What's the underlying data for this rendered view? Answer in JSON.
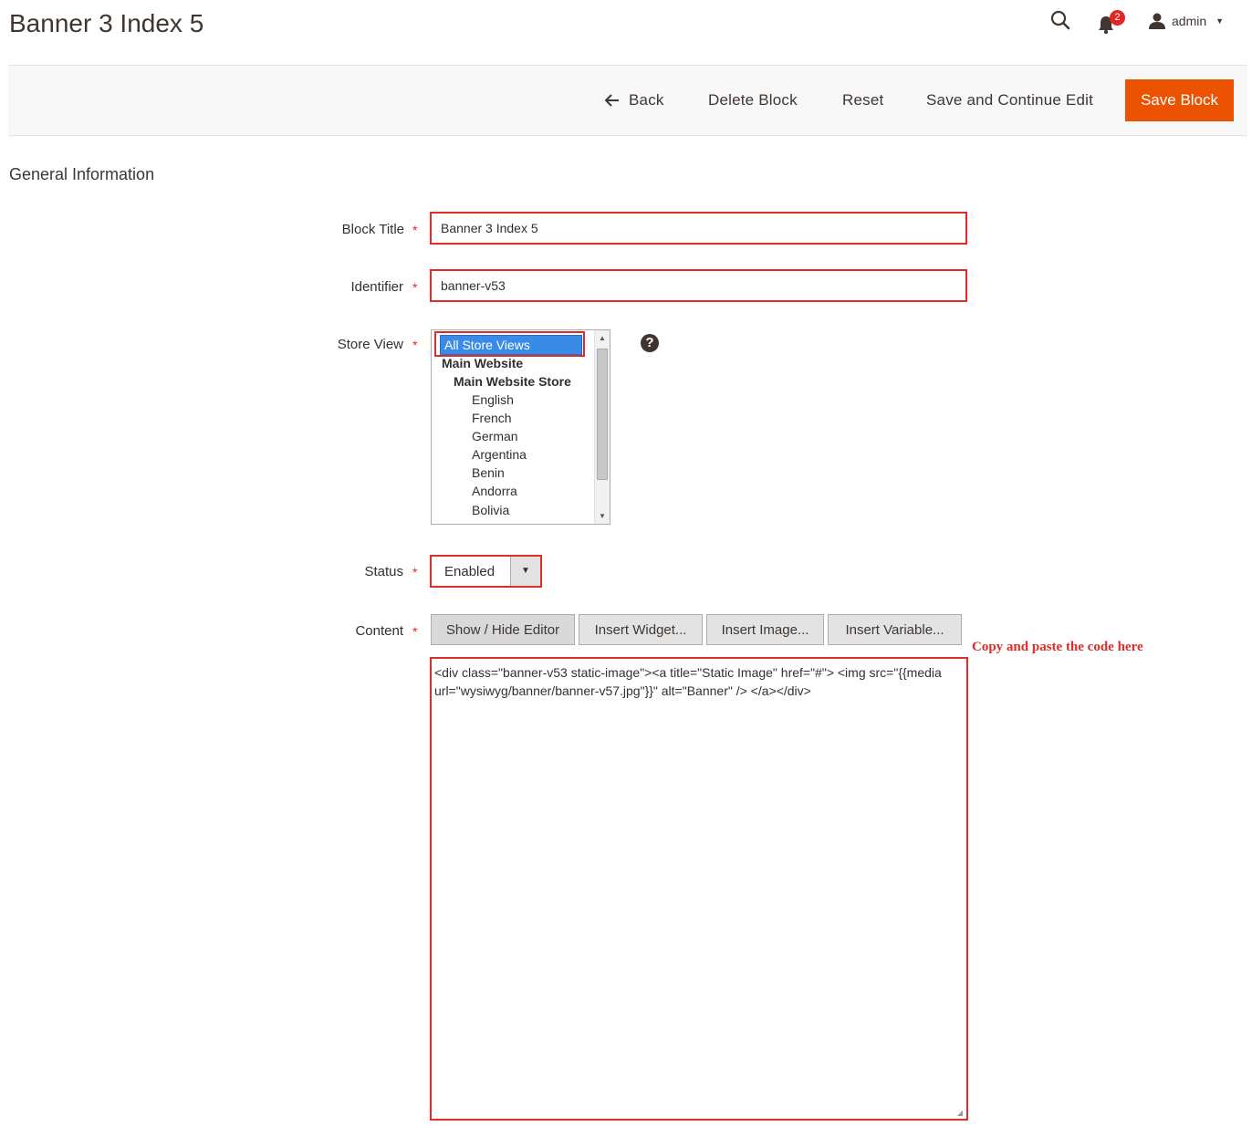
{
  "page": {
    "title": "Banner 3 Index 5"
  },
  "header": {
    "notifications_count": "2",
    "user_name": "admin"
  },
  "toolbar": {
    "back_label": "Back",
    "delete_label": "Delete Block",
    "reset_label": "Reset",
    "save_continue_label": "Save and Continue Edit",
    "save_label": "Save Block"
  },
  "section": {
    "title": "General Information"
  },
  "form": {
    "block_title": {
      "label": "Block Title",
      "value": "Banner 3 Index 5"
    },
    "identifier": {
      "label": "Identifier",
      "value": "banner-v53"
    },
    "store_view": {
      "label": "Store View",
      "options": [
        "All Store Views",
        "Main Website",
        "Main Website Store",
        "English",
        "French",
        "German",
        "Argentina",
        "Benin",
        "Andorra",
        "Bolivia"
      ],
      "selected": "All Store Views"
    },
    "status": {
      "label": "Status",
      "value": "Enabled"
    },
    "content": {
      "label": "Content",
      "buttons": {
        "show_hide": "Show / Hide Editor",
        "insert_widget": "Insert Widget...",
        "insert_image": "Insert Image...",
        "insert_variable": "Insert Variable..."
      },
      "value": "<div class=\"banner-v53 static-image\"><a title=\"Static Image\" href=\"#\"> <img src=\"{{media url=\"wysiwyg/banner/banner-v57.jpg\"}}\" alt=\"Banner\" /> </a></div>"
    }
  },
  "annotation": {
    "text": "Copy and paste the code here"
  },
  "colors": {
    "accent": "#eb5202",
    "highlight": "#e02b27",
    "selection": "#3a8be8"
  }
}
